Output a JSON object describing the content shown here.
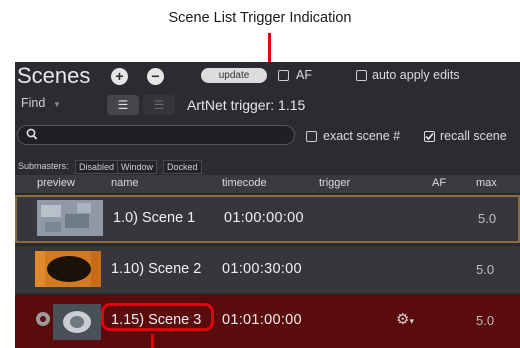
{
  "annotation": {
    "title": "Scene List Trigger Indication"
  },
  "toolbar": {
    "title": "Scenes",
    "add_glyph": "+",
    "remove_glyph": "−",
    "update_label": "update",
    "af_label": "AF",
    "auto_apply_label": "auto apply edits",
    "find_label": "Find",
    "artnet_trigger": "ArtNet trigger: 1.15"
  },
  "search": {
    "exact_scene_label": "exact scene #",
    "recall_scene_label": "recall scene",
    "recall_checked": true
  },
  "submasters": {
    "label": "Submasters:",
    "options": [
      "Disabled",
      "Window",
      "Docked"
    ]
  },
  "table": {
    "columns": [
      "preview",
      "name",
      "timecode",
      "trigger",
      "AF",
      "max"
    ],
    "rows": [
      {
        "name": "1.0) Scene 1",
        "timecode": "01:00:00:00",
        "trigger": "",
        "max": "5.0",
        "state": "selected"
      },
      {
        "name": "1.10) Scene 2",
        "timecode": "01:00:30:00",
        "trigger": "",
        "max": "5.0",
        "state": "normal"
      },
      {
        "name": "1.15) Scene 3",
        "timecode": "01:01:00:00",
        "trigger": "gear-icon",
        "max": "5.0",
        "state": "triggered"
      }
    ]
  },
  "colors": {
    "accent_red": "#e3000f",
    "panel_bg": "#2b2c31",
    "triggered_row": "#5a0b0c",
    "selected_border": "#8a6b3c"
  }
}
